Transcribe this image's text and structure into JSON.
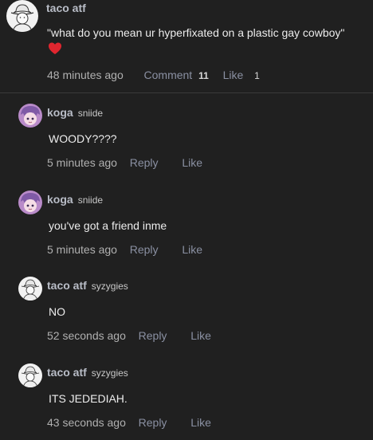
{
  "post": {
    "author": "taco atf",
    "text": "\"what do you mean ur hyperfixated on a plastic gay cowboy\"",
    "heart_icon": "heart-emoji",
    "time": "48 minutes ago",
    "comment_label": "Comment",
    "comment_count": "11",
    "like_label": "Like",
    "like_count": "1"
  },
  "replies": [
    {
      "author": "koga",
      "handle": "sniide",
      "text": "WOODY????",
      "time": "5 minutes ago",
      "reply_label": "Reply",
      "like_label": "Like",
      "avatar": "anime-avatar"
    },
    {
      "author": "koga",
      "handle": "sniide",
      "text": "you've got a friend inme",
      "time": "5 minutes ago",
      "reply_label": "Reply",
      "like_label": "Like",
      "avatar": "anime-avatar"
    },
    {
      "author": "taco atf",
      "handle": "syzygies",
      "text": "NO",
      "time": "52 seconds ago",
      "reply_label": "Reply",
      "like_label": "Like",
      "avatar": "cowboy-sketch-avatar"
    },
    {
      "author": "taco atf",
      "handle": "syzygies",
      "text": "ITS JEDEDIAH.",
      "time": "43 seconds ago",
      "reply_label": "Reply",
      "like_label": "Like",
      "avatar": "cowboy-sketch-avatar"
    }
  ],
  "colors": {
    "background": "#202020",
    "link": "#8a90a2",
    "heart": "#e0262f"
  }
}
